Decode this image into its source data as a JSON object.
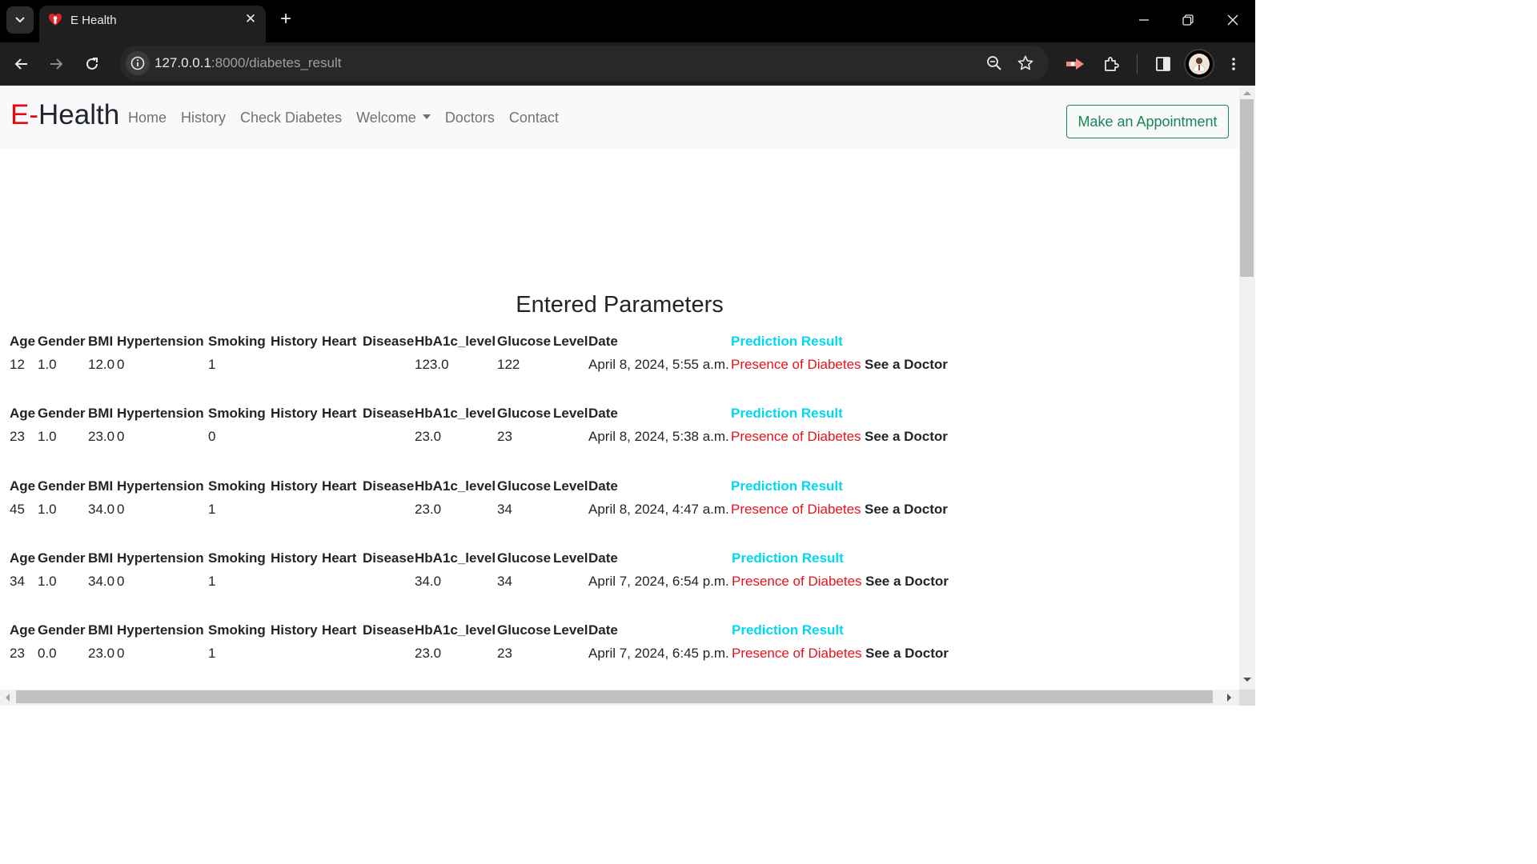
{
  "browser": {
    "tab_title": "E Health",
    "url_host": "127.0.0.1",
    "url_rest": ":8000/diabetes_result"
  },
  "navbar": {
    "brand_prefix": "E-",
    "brand_suffix": "Health",
    "links": [
      "Home",
      "History",
      "Check Diabetes",
      "Welcome",
      "Doctors",
      "Contact"
    ],
    "appointment_button": "Make an Appointment"
  },
  "page": {
    "title": "Entered Parameters"
  },
  "table": {
    "headers": [
      "Age",
      "Gender",
      "BMI",
      "Hypertension",
      "Smoking",
      "History",
      "Heart",
      "Disease",
      "HbA1c_level",
      "Glucose",
      "Level",
      "Date",
      "Prediction Result"
    ],
    "rows": [
      {
        "age": "12",
        "gender": "1.0",
        "bmi": "12.0",
        "hypertension": "0",
        "smoking": "1",
        "hba1c": "123.0",
        "glucose": "122",
        "date": "April 8, 2024, 5:55 a.m.",
        "prediction": "Presence of Diabetes",
        "advice": "See a Doctor"
      },
      {
        "age": "23",
        "gender": "1.0",
        "bmi": "23.0",
        "hypertension": "0",
        "smoking": "0",
        "hba1c": "23.0",
        "glucose": "23",
        "date": "April 8, 2024, 5:38 a.m.",
        "prediction": "Presence of Diabetes",
        "advice": "See a Doctor"
      },
      {
        "age": "45",
        "gender": "1.0",
        "bmi": "34.0",
        "hypertension": "0",
        "smoking": "1",
        "hba1c": "23.0",
        "glucose": "34",
        "date": "April 8, 2024, 4:47 a.m.",
        "prediction": "Presence of Diabetes",
        "advice": "See a Doctor"
      },
      {
        "age": "34",
        "gender": "1.0",
        "bmi": "34.0",
        "hypertension": "0",
        "smoking": "1",
        "hba1c": "34.0",
        "glucose": "34",
        "date": "April 7, 2024, 6:54 p.m.",
        "prediction": "Presence of Diabetes",
        "advice": "See a Doctor"
      },
      {
        "age": "23",
        "gender": "0.0",
        "bmi": "23.0",
        "hypertension": "0",
        "smoking": "1",
        "hba1c": "23.0",
        "glucose": "23",
        "date": "April 7, 2024, 6:45 p.m.",
        "prediction": "Presence of Diabetes",
        "advice": "See a Doctor"
      }
    ]
  },
  "colors": {
    "brand_red": "#e50914",
    "prediction_header": "#00d8f0",
    "prediction_value": "#e3131b",
    "appointment_green": "#198754"
  },
  "icons": [
    "tab-search-icon",
    "favicon-icon",
    "close-icon",
    "new-tab-icon",
    "minimize-icon",
    "restore-icon",
    "window-close-icon",
    "back-icon",
    "forward-icon",
    "reload-icon",
    "site-info-icon",
    "zoom-icon",
    "bookmark-star-icon",
    "extension-icon",
    "puzzle-icon",
    "side-panel-icon",
    "profile-avatar",
    "menu-icon"
  ]
}
